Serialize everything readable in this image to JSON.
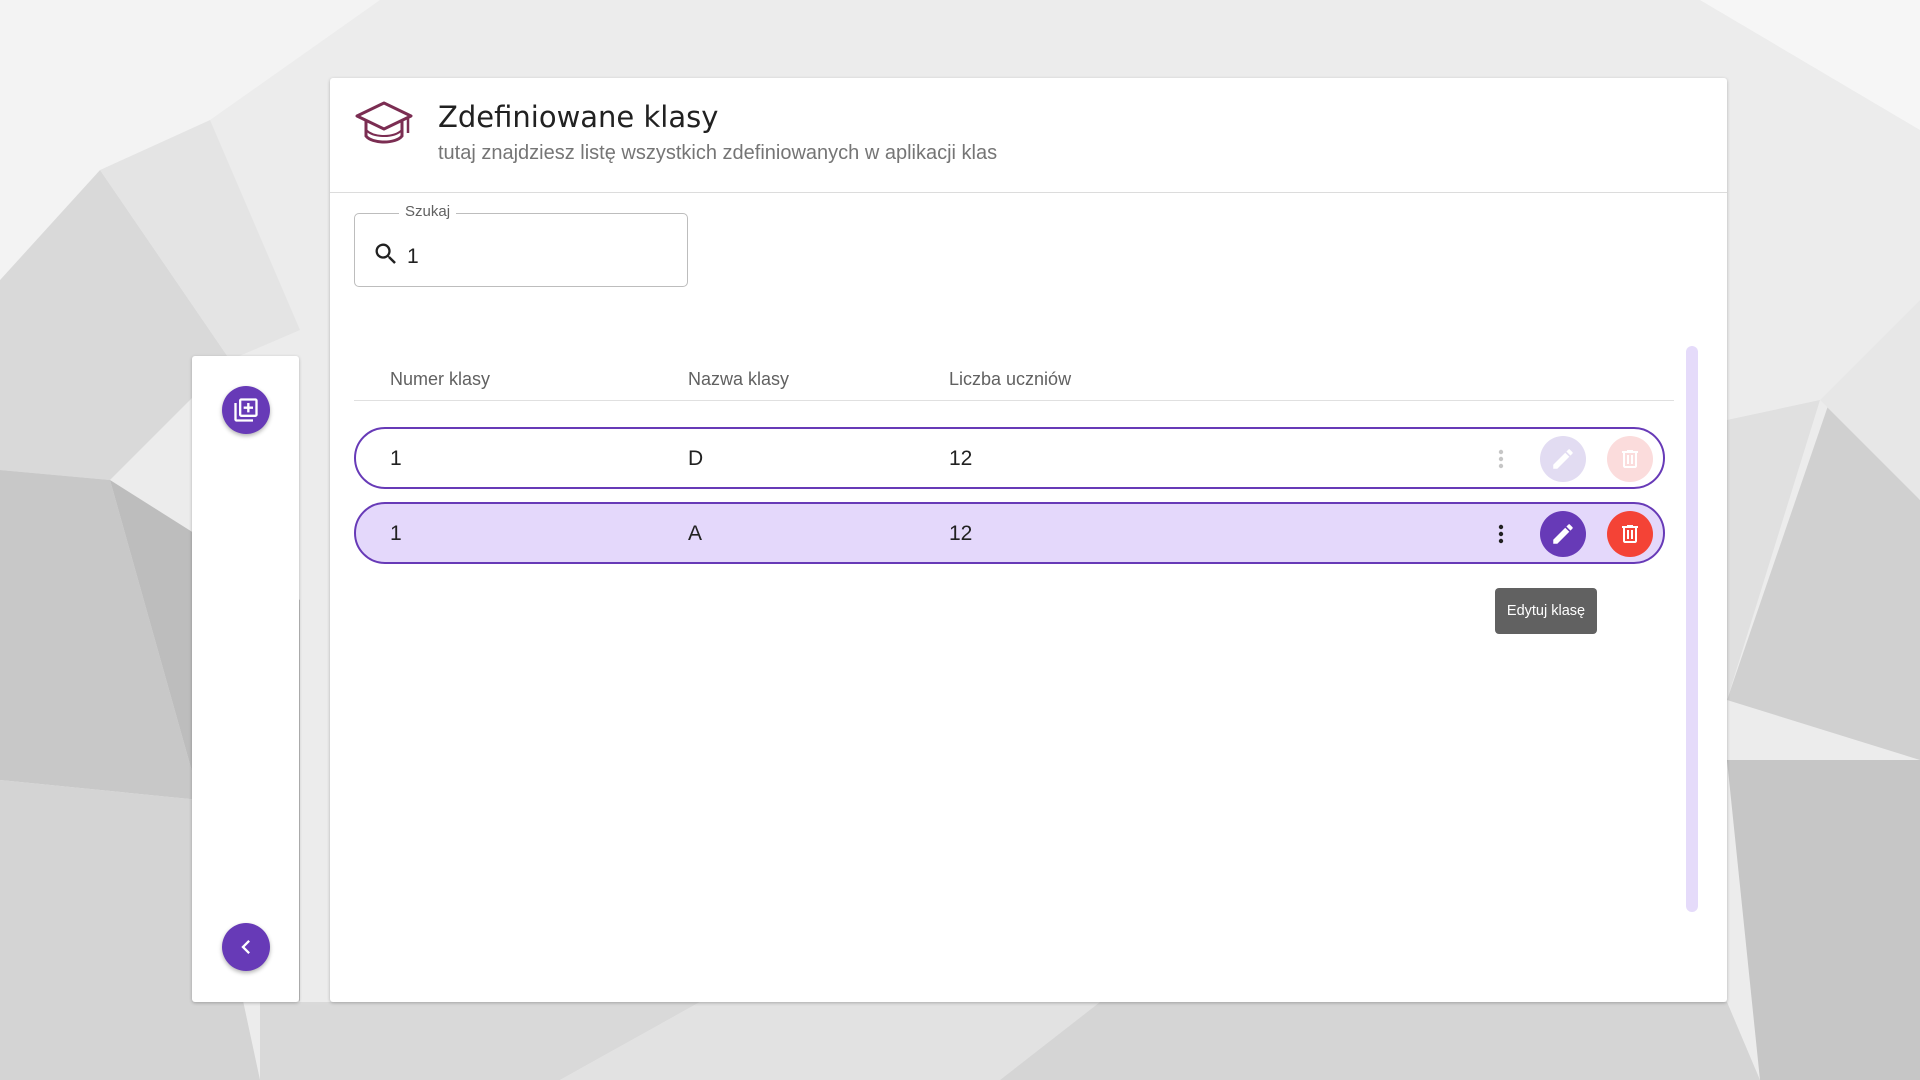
{
  "header": {
    "title": "Zdefiniowane klasy",
    "subtitle": "tutaj znajdziesz listę wszystkich zdefiniowanych w aplikacji klas",
    "icon": "graduation-cap-icon"
  },
  "search": {
    "label": "Szukaj",
    "value": "1"
  },
  "table": {
    "columns": [
      "Numer klasy",
      "Nazwa klasy",
      "Liczba uczniów"
    ],
    "rows": [
      {
        "number": "1",
        "name": "D",
        "students": "12"
      },
      {
        "number": "1",
        "name": "A",
        "students": "12"
      }
    ]
  },
  "tooltip": "Edytuj klasę",
  "side": {
    "add_icon": "add-to-queue-icon",
    "back_icon": "chevron-left-icon"
  },
  "colors": {
    "accent": "#673ab7",
    "danger": "#f44336",
    "row_selected": "#e4d8fb"
  }
}
